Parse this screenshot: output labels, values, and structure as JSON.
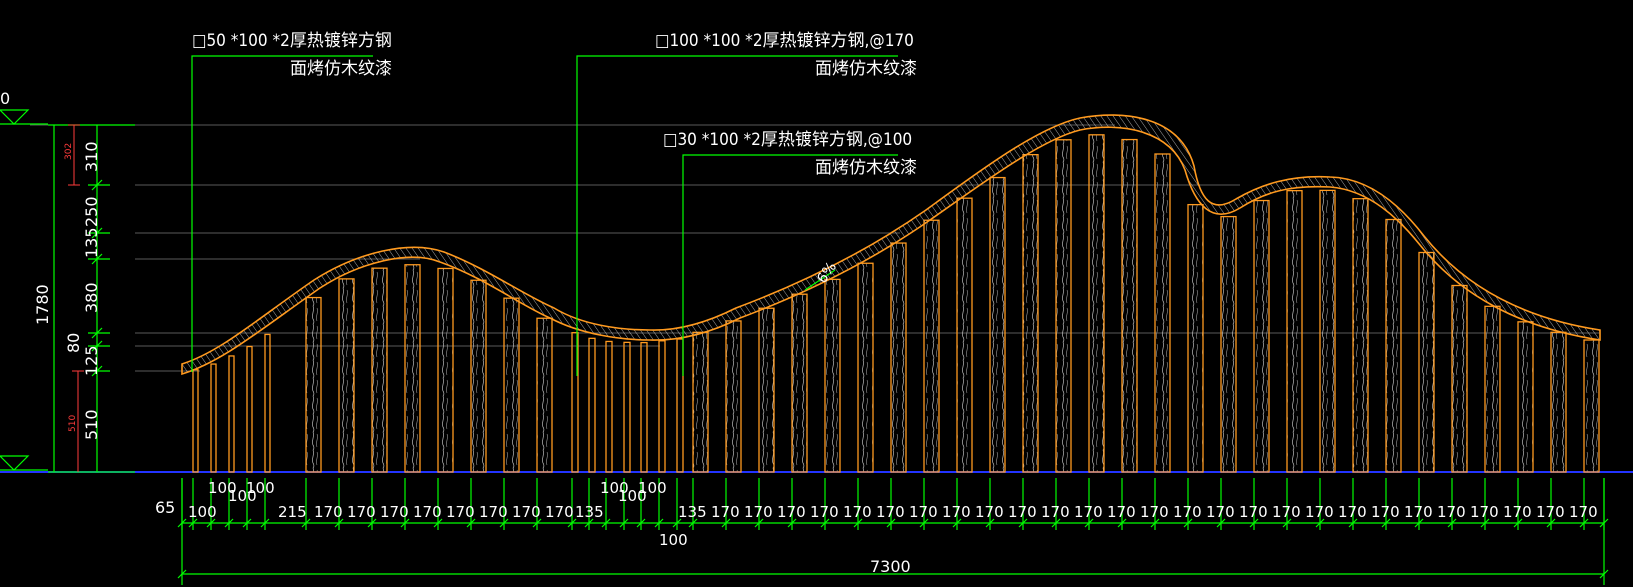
{
  "callouts": [
    {
      "line1": "□50 *100 *2厚热镀锌方钢",
      "line2": "面烤仿木纹漆"
    },
    {
      "line1": "□100 *100 *2厚热镀锌方钢,@170",
      "line2": "面烤仿木纹漆"
    },
    {
      "line1": "□30 *100 *2厚热镀锌方钢,@100",
      "line2": "面烤仿木纹漆"
    }
  ],
  "vertical_dims": {
    "total": "1780",
    "segments": [
      "310",
      "250",
      "135",
      "380",
      "80",
      "125",
      "510"
    ],
    "red_small_top": "302",
    "red_small_bottom": "510"
  },
  "slope_label": "6%",
  "bottom_dims": {
    "row1": [
      "100",
      "100",
      "100",
      "100",
      "100",
      "100"
    ],
    "row2": [
      "65",
      "100",
      "215",
      "170",
      "170",
      "170",
      "170",
      "170",
      "170",
      "170",
      "170",
      "135",
      "135",
      "170",
      "170",
      "170",
      "170",
      "170",
      "170",
      "170",
      "170",
      "170",
      "170",
      "170",
      "170",
      "170",
      "170",
      "170",
      "170",
      "170",
      "170",
      "170",
      "170",
      "170",
      "170",
      "170",
      "170",
      "170",
      "170",
      "170"
    ],
    "mid_below": "100",
    "total": "7300"
  },
  "colors": {
    "background": "#000000",
    "dim_line": "#00ff00",
    "slat": "#ff9a1f",
    "text": "#ffffff",
    "red": "#ff3b3b",
    "ground": "#2233ff",
    "guide": "#6a6a6a"
  }
}
